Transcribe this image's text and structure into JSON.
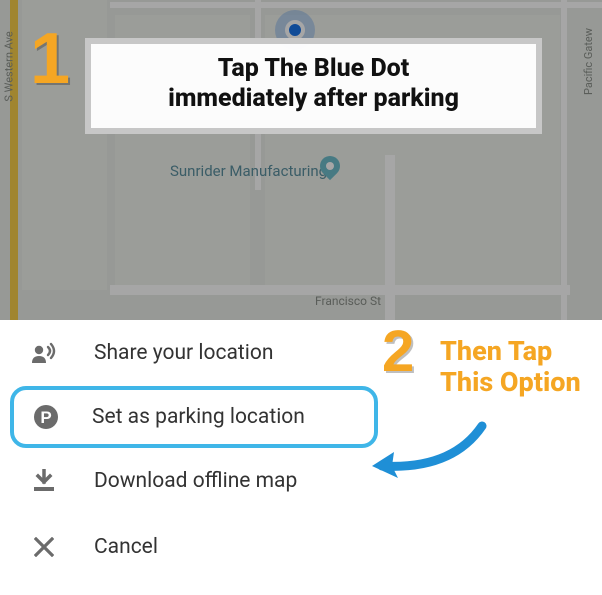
{
  "annotations": {
    "step1_number": "1",
    "step1_line1": "Tap The Blue Dot",
    "step1_line2": "immediately after parking",
    "step2_number": "2",
    "step2_line1": "Then Tap",
    "step2_line2": "This Option"
  },
  "map": {
    "street_left": "S Western Ave",
    "street_right": "Pacific Gatew",
    "street_bottom": "Francisco St",
    "poi_label": "Sunrider Manufacturing"
  },
  "sheet": {
    "items": [
      {
        "label": "Share your location",
        "icon": "share-location-icon"
      },
      {
        "label": "Set as parking location",
        "icon": "parking-icon"
      },
      {
        "label": "Download offline map",
        "icon": "download-icon"
      },
      {
        "label": "Cancel",
        "icon": "close-icon"
      }
    ]
  }
}
